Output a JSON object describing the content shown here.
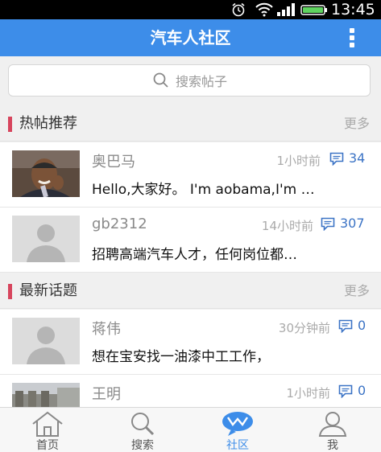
{
  "status_bar": {
    "time": "13:45"
  },
  "header": {
    "title": "汽车人社区"
  },
  "search": {
    "placeholder": "搜索帖子"
  },
  "sections": [
    {
      "title": "热帖推荐",
      "more": "更多",
      "posts": [
        {
          "author": "奥巴马",
          "time": "1小时前",
          "comments": "34",
          "summary": "Hello,大家好。 I'm aobama,I'm …",
          "avatar": "photo"
        },
        {
          "author": "gb2312",
          "time": "14小时前",
          "comments": "307",
          "summary": "招聘高端汽车人才，任何岗位都…",
          "avatar": "default"
        }
      ]
    },
    {
      "title": "最新话题",
      "more": "更多",
      "posts": [
        {
          "author": "蒋伟",
          "time": "30分钟前",
          "comments": "0",
          "summary": "想在宝安找一油漆中工工作，",
          "avatar": "default"
        },
        {
          "author": "王明",
          "time": "1小时前",
          "comments": "0",
          "summary": "",
          "avatar": "photo"
        }
      ]
    }
  ],
  "tabs": [
    {
      "label": "首页",
      "icon": "home-icon",
      "active": false
    },
    {
      "label": "搜索",
      "icon": "search-icon",
      "active": false
    },
    {
      "label": "社区",
      "icon": "community-icon",
      "active": true
    },
    {
      "label": "我",
      "icon": "user-icon",
      "active": false
    }
  ],
  "colors": {
    "primary": "#3d8de9",
    "section_marker": "#d7455d",
    "comment_count": "#3b73c5"
  }
}
